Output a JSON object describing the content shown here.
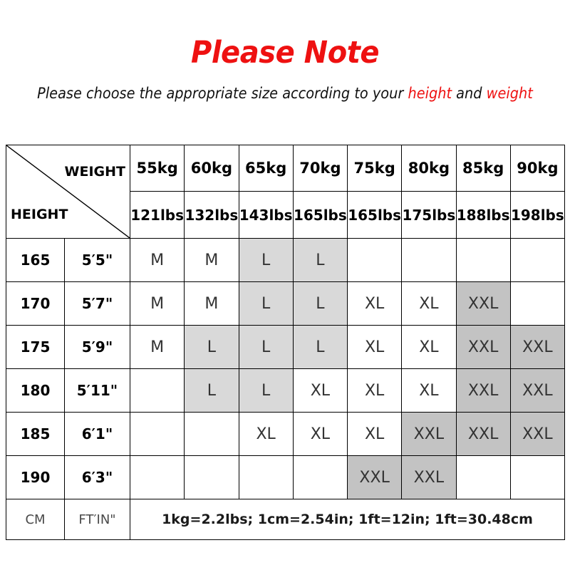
{
  "header": {
    "title": "Please Note",
    "subtitle_prefix": "Please choose the appropriate size according to your ",
    "subtitle_hl1": "height",
    "subtitle_mid": " and ",
    "subtitle_hl2": "weight"
  },
  "colors": {
    "title_red": "#ee1111",
    "shade_light": "#d9d9d9",
    "shade_dark": "#c3c3c3",
    "border": "#000000"
  },
  "table": {
    "corner": {
      "weight_label": "WEIGHT",
      "height_label": "HEIGHT"
    },
    "weights_kg": [
      "55kg",
      "60kg",
      "65kg",
      "70kg",
      "75kg",
      "80kg",
      "85kg",
      "90kg"
    ],
    "weights_lbs": [
      "121lbs",
      "132lbs",
      "143lbs",
      "165lbs",
      "165lbs",
      "175lbs",
      "188lbs",
      "198lbs"
    ],
    "rows": [
      {
        "cm": "165",
        "ftin": "5′5\"",
        "sizes": [
          "M",
          "M",
          "L",
          "L",
          "",
          "",
          "",
          ""
        ],
        "shades": [
          "none",
          "none",
          "light",
          "light",
          "none",
          "none",
          "none",
          "none"
        ]
      },
      {
        "cm": "170",
        "ftin": "5′7\"",
        "sizes": [
          "M",
          "M",
          "L",
          "L",
          "XL",
          "XL",
          "XXL",
          ""
        ],
        "shades": [
          "none",
          "none",
          "light",
          "light",
          "none",
          "none",
          "dark",
          "none"
        ]
      },
      {
        "cm": "175",
        "ftin": "5′9\"",
        "sizes": [
          "M",
          "L",
          "L",
          "L",
          "XL",
          "XL",
          "XXL",
          "XXL"
        ],
        "shades": [
          "none",
          "light",
          "light",
          "light",
          "none",
          "none",
          "dark",
          "dark"
        ]
      },
      {
        "cm": "180",
        "ftin": "5′11\"",
        "sizes": [
          "",
          "L",
          "L",
          "XL",
          "XL",
          "XL",
          "XXL",
          "XXL"
        ],
        "shades": [
          "none",
          "light",
          "light",
          "none",
          "none",
          "none",
          "dark",
          "dark"
        ]
      },
      {
        "cm": "185",
        "ftin": "6′1\"",
        "sizes": [
          "",
          "",
          "XL",
          "XL",
          "XL",
          "XXL",
          "XXL",
          "XXL"
        ],
        "shades": [
          "none",
          "none",
          "none",
          "none",
          "none",
          "dark",
          "dark",
          "dark"
        ]
      },
      {
        "cm": "190",
        "ftin": "6′3\"",
        "sizes": [
          "",
          "",
          "",
          "",
          "XXL",
          "XXL",
          "",
          ""
        ],
        "shades": [
          "none",
          "none",
          "none",
          "none",
          "dark",
          "dark",
          "none",
          "none"
        ]
      }
    ],
    "footer": {
      "unit_cm": "CM",
      "unit_ftin": "FT′IN\"",
      "note": "1kg=2.2lbs; 1cm=2.54in; 1ft=12in; 1ft=30.48cm"
    }
  }
}
